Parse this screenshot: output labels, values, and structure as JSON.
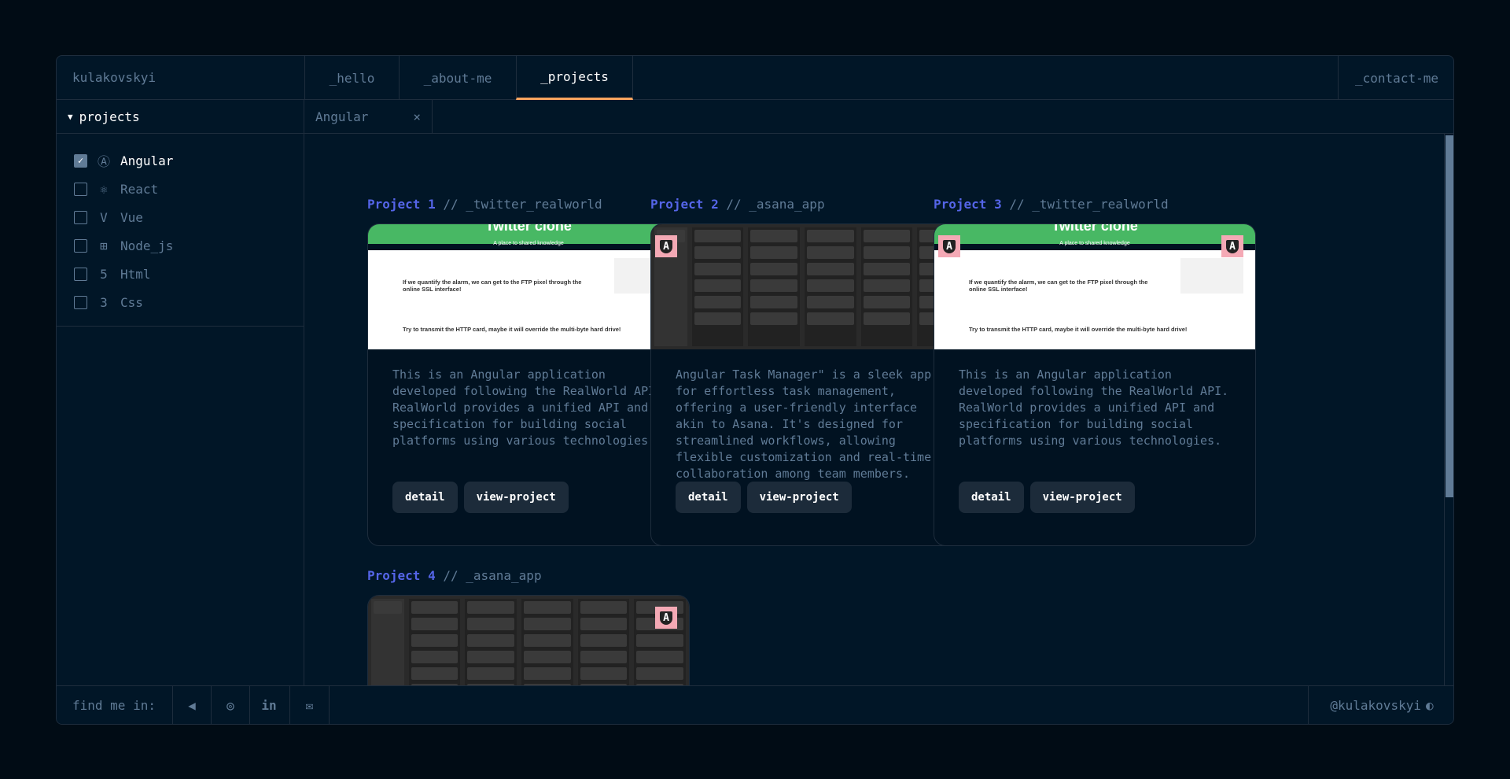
{
  "header": {
    "brand": "kulakovskyi",
    "tabs": [
      {
        "label": "_hello"
      },
      {
        "label": "_about-me"
      },
      {
        "label": "_projects",
        "active": true
      }
    ],
    "contact": "_contact-me"
  },
  "sidebar": {
    "title": "projects",
    "items": [
      {
        "label": "Angular",
        "checked": true,
        "icon": "angular-icon",
        "glyph": "Ⓐ"
      },
      {
        "label": "React",
        "checked": false,
        "icon": "react-icon",
        "glyph": "⚛"
      },
      {
        "label": "Vue",
        "checked": false,
        "icon": "vue-icon",
        "glyph": "V"
      },
      {
        "label": "Node_js",
        "checked": false,
        "icon": "nodejs-icon",
        "glyph": "⊞"
      },
      {
        "label": "Html",
        "checked": false,
        "icon": "html5-icon",
        "glyph": "5"
      },
      {
        "label": "Css",
        "checked": false,
        "icon": "css3-icon",
        "glyph": "3"
      }
    ]
  },
  "open_tab": {
    "label": "Angular",
    "close": "×"
  },
  "projects": [
    {
      "num": "Project 1",
      "name": "// _twitter_realworld",
      "thumb": "twitter",
      "thumb_title": "Twitter clone",
      "thumb_sub": "A place to shared knowledge",
      "thumb_post": "If we quantify the alarm, we can get to the FTP pixel through the online SSL interface!",
      "thumb_post2": "Try to transmit the HTTP card, maybe it will override the multi-byte hard drive!",
      "desc": "This is an Angular application developed following the RealWorld API. RealWorld provides a unified API and specification for building social platforms using various technologies.",
      "detail": "detail",
      "view": "view-project"
    },
    {
      "num": "Project 2",
      "name": "// _asana_app",
      "thumb": "asana",
      "desc": "Angular Task Manager\" is a sleek app for effortless task management, offering a user-friendly interface akin to Asana. It's designed for streamlined workflows, allowing flexible customization and real-time collaboration among team members.",
      "detail": "detail",
      "view": "view-project"
    },
    {
      "num": "Project 3",
      "name": "// _twitter_realworld",
      "thumb": "twitter",
      "thumb_title": "Twitter clone",
      "thumb_sub": "A place to shared knowledge",
      "thumb_post": "If we quantify the alarm, we can get to the FTP pixel through the online SSL interface!",
      "thumb_post2": "Try to transmit the HTTP card, maybe it will override the multi-byte hard drive!",
      "desc": "This is an Angular application developed following the RealWorld API. RealWorld provides a unified API and specification for building social platforms using various technologies.",
      "detail": "detail",
      "view": "view-project"
    },
    {
      "num": "Project 4",
      "name": "// _asana_app",
      "thumb": "asana"
    }
  ],
  "footer": {
    "label": "find me in:",
    "socials": [
      {
        "icon": "telegram-icon",
        "glyph": "◀"
      },
      {
        "icon": "instagram-icon",
        "glyph": "◎"
      },
      {
        "icon": "linkedin-icon",
        "glyph": "in"
      },
      {
        "icon": "mail-icon",
        "glyph": "✉"
      }
    ],
    "github": "@kulakovskyi"
  },
  "colors": {
    "accent": "#fea55f",
    "project_title": "#5565e8",
    "background": "#011627",
    "border": "#1e2d3d",
    "text": "#607b96"
  }
}
